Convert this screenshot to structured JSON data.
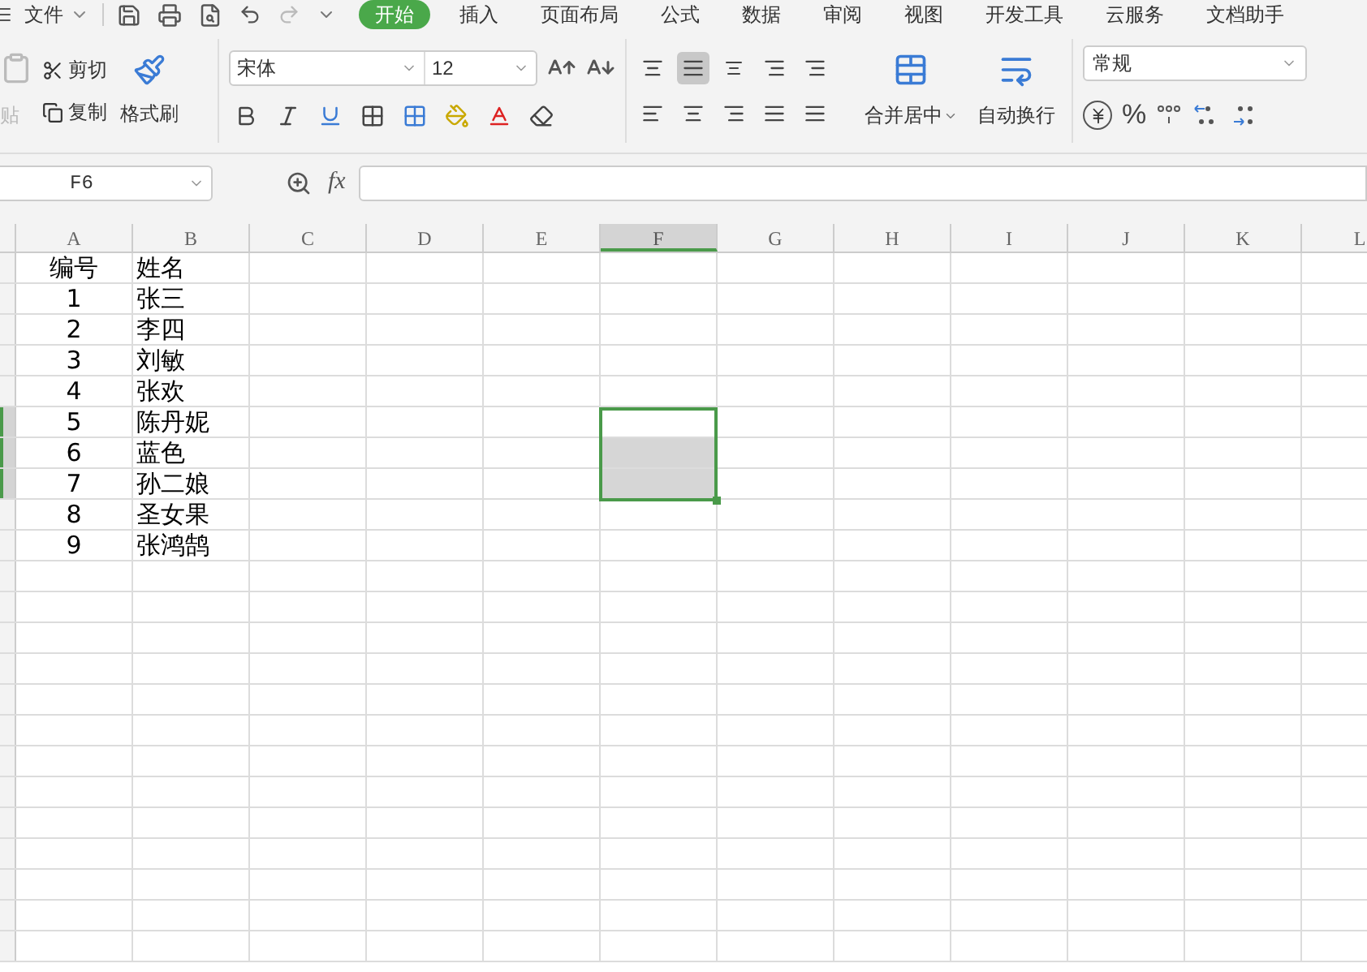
{
  "menu_bar": {
    "file_label": "文件",
    "tabs": [
      {
        "label": "开始",
        "selected": true
      },
      {
        "label": "插入",
        "selected": false
      },
      {
        "label": "页面布局",
        "selected": false
      },
      {
        "label": "公式",
        "selected": false
      },
      {
        "label": "数据",
        "selected": false
      },
      {
        "label": "审阅",
        "selected": false
      },
      {
        "label": "视图",
        "selected": false
      },
      {
        "label": "开发工具",
        "selected": false
      },
      {
        "label": "云服务",
        "selected": false
      },
      {
        "label": "文档助手",
        "selected": false
      }
    ]
  },
  "ribbon": {
    "paste_label": "贴",
    "cut_label": "剪切",
    "copy_label": "复制",
    "format_painter_label": "格式刷",
    "font_name": "宋体",
    "font_size": "12",
    "merge_label": "合并居中",
    "wrap_label": "自动换行",
    "number_format": "常规",
    "percent_label": "%",
    "center_align_selected": true
  },
  "formula_bar": {
    "name_box": "F6",
    "function_label": "fx"
  },
  "columns": [
    {
      "label": "A",
      "selected": false
    },
    {
      "label": "B",
      "selected": false
    },
    {
      "label": "C",
      "selected": false
    },
    {
      "label": "D",
      "selected": false
    },
    {
      "label": "E",
      "selected": false
    },
    {
      "label": "F",
      "selected": true
    },
    {
      "label": "G",
      "selected": false
    },
    {
      "label": "H",
      "selected": false
    },
    {
      "label": "I",
      "selected": false
    },
    {
      "label": "J",
      "selected": false
    },
    {
      "label": "K",
      "selected": false
    },
    {
      "label": "L",
      "selected": false
    }
  ],
  "rows": [
    {
      "cells": [
        "编号",
        "姓名"
      ],
      "selected": false
    },
    {
      "cells": [
        "1",
        "张三"
      ],
      "selected": false
    },
    {
      "cells": [
        "2",
        "李四"
      ],
      "selected": false
    },
    {
      "cells": [
        "3",
        "刘敏"
      ],
      "selected": false
    },
    {
      "cells": [
        "4",
        "张欢"
      ],
      "selected": false
    },
    {
      "cells": [
        "5",
        "陈丹妮"
      ],
      "selected": true
    },
    {
      "cells": [
        "6",
        "蓝色"
      ],
      "selected": true
    },
    {
      "cells": [
        "7",
        "孙二娘"
      ],
      "selected": true
    },
    {
      "cells": [
        "8",
        "圣女果"
      ],
      "selected": false
    },
    {
      "cells": [
        "9",
        "张鸿鹄"
      ],
      "selected": false
    }
  ]
}
